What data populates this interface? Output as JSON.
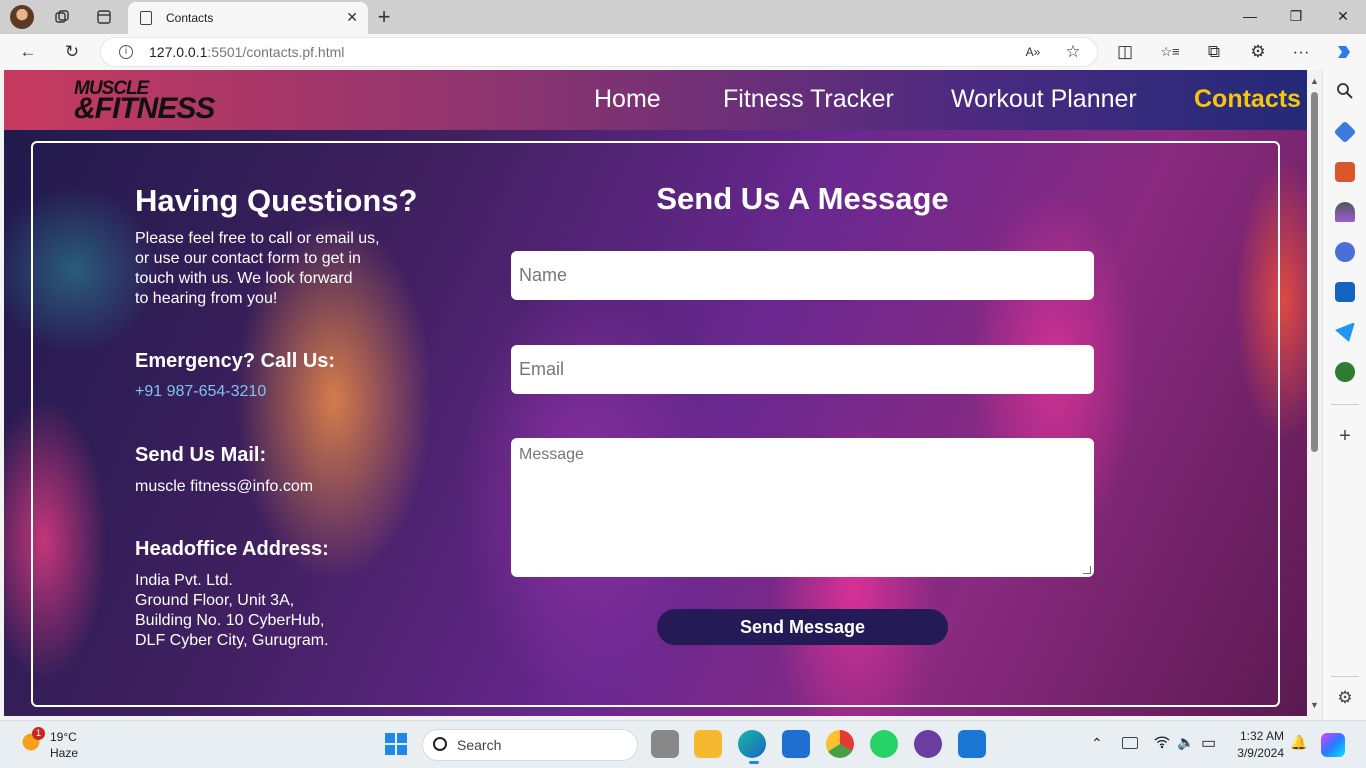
{
  "browser": {
    "tab_title": "Contacts",
    "url_host": "127.0.0.1",
    "url_rest": ":5501/contacts.pf.html",
    "tab_close": "✕",
    "new_tab": "+",
    "controls": {
      "minimize": "—",
      "maximize": "❐",
      "close": "✕"
    },
    "nav_icons": {
      "back": "←",
      "reload": "↻",
      "read_aloud": "A»",
      "favorite": "☆",
      "split": "◫",
      "favorites": "☆≡",
      "collections": "⧉",
      "extensions": "⚙",
      "more": "···"
    }
  },
  "site": {
    "logo_line1": "MUSCLE",
    "logo_line2": "&FITNESS",
    "nav": [
      "Home",
      "Fitness Tracker",
      "Workout Planner",
      "Contacts"
    ],
    "active_nav": "Contacts"
  },
  "contact": {
    "heading": "Having Questions?",
    "intro_lines": [
      "Please feel free to call or email us,",
      "or use our contact form to get in",
      "touch with us. We look forward",
      "to hearing from you!"
    ],
    "emergency_heading": "Emergency? Call Us:",
    "phone": "+91 987-654-3210",
    "mail_heading": "Send Us Mail:",
    "email": "muscle fitness@info.com",
    "address_heading": "Headoffice Address:",
    "address_lines": [
      "India Pvt. Ltd.",
      "Ground Floor, Unit 3A,",
      "Building No. 10 CyberHub,",
      "DLF Cyber City, Gurugram."
    ]
  },
  "form": {
    "title": "Send Us A Message",
    "name_placeholder": "Name",
    "email_placeholder": "Email",
    "message_placeholder": "Message",
    "submit_label": "Send Message"
  },
  "taskbar": {
    "weather_temp": "19°C",
    "weather_desc": "Haze",
    "weather_badge": "1",
    "search_placeholder": "Search",
    "time": "1:32 AM",
    "date": "3/9/2024",
    "tray_icons": {
      "chevron": "⌃",
      "wifi": "wifi",
      "volume": "🔈",
      "battery": "▭",
      "bell": "🔔"
    }
  },
  "colors": {
    "accent_nav": "#f6c60d",
    "phone_link": "#7ec3f0",
    "button_bg": "#241a55"
  }
}
